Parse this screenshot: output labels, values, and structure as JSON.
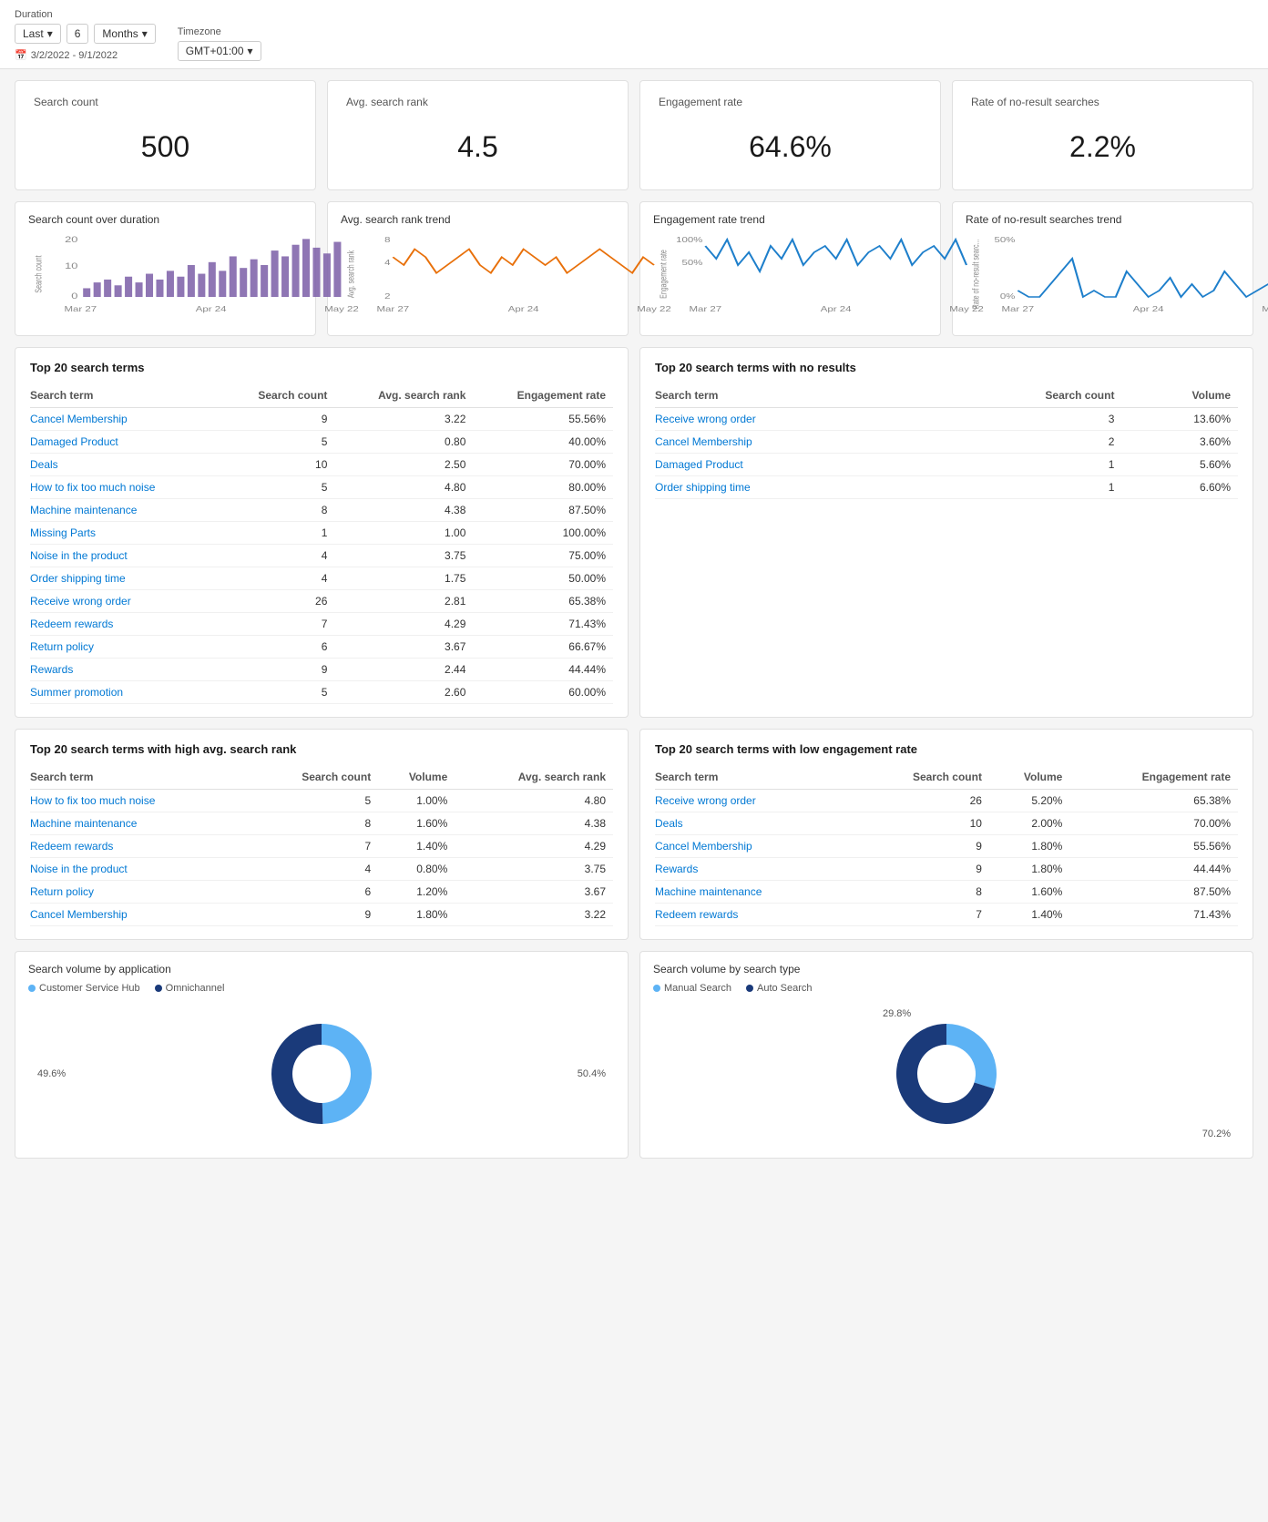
{
  "topbar": {
    "duration_label": "Duration",
    "period_option": "Last",
    "period_value": "6",
    "period_unit": "Months",
    "timezone_label": "Timezone",
    "timezone_value": "GMT+01:00",
    "date_range_icon": "calendar-icon",
    "date_range": "3/2/2022 - 9/1/2022"
  },
  "metrics": [
    {
      "title": "Search count",
      "value": "500"
    },
    {
      "title": "Avg. search rank",
      "value": "4.5"
    },
    {
      "title": "Engagement rate",
      "value": "64.6%"
    },
    {
      "title": "Rate of no-result searches",
      "value": "2.2%"
    }
  ],
  "trend_charts": [
    {
      "title": "Search count over duration",
      "y_label": "Search count",
      "color": "#7b5ea7",
      "type": "bar"
    },
    {
      "title": "Avg. search rank trend",
      "y_label": "Avg. search rank",
      "color": "#e8700a",
      "type": "line"
    },
    {
      "title": "Engagement rate trend",
      "y_label": "Engagement rate",
      "color": "#1e7fcb",
      "type": "line"
    },
    {
      "title": "Rate of no-result searches trend",
      "y_label": "Rate of no-result searc...",
      "color": "#1e7fcb",
      "type": "line"
    }
  ],
  "x_labels": [
    "Mar 27",
    "Apr 24",
    "May 22"
  ],
  "top20_table": {
    "title": "Top 20 search terms",
    "headers": [
      "Search term",
      "Search count",
      "Avg. search rank",
      "Engagement rate"
    ],
    "rows": [
      [
        "Cancel Membership",
        "9",
        "3.22",
        "55.56%"
      ],
      [
        "Damaged Product",
        "5",
        "0.80",
        "40.00%"
      ],
      [
        "Deals",
        "10",
        "2.50",
        "70.00%"
      ],
      [
        "How to fix too much noise",
        "5",
        "4.80",
        "80.00%"
      ],
      [
        "Machine maintenance",
        "8",
        "4.38",
        "87.50%"
      ],
      [
        "Missing Parts",
        "1",
        "1.00",
        "100.00%"
      ],
      [
        "Noise in the product",
        "4",
        "3.75",
        "75.00%"
      ],
      [
        "Order shipping time",
        "4",
        "1.75",
        "50.00%"
      ],
      [
        "Receive wrong order",
        "26",
        "2.81",
        "65.38%"
      ],
      [
        "Redeem rewards",
        "7",
        "4.29",
        "71.43%"
      ],
      [
        "Return policy",
        "6",
        "3.67",
        "66.67%"
      ],
      [
        "Rewards",
        "9",
        "2.44",
        "44.44%"
      ],
      [
        "Summer promotion",
        "5",
        "2.60",
        "60.00%"
      ]
    ]
  },
  "no_results_table": {
    "title": "Top 20 search terms with no results",
    "headers": [
      "Search term",
      "Search count",
      "Volume"
    ],
    "rows": [
      [
        "Receive wrong order",
        "3",
        "13.60%"
      ],
      [
        "Cancel Membership",
        "2",
        "3.60%"
      ],
      [
        "Damaged Product",
        "1",
        "5.60%"
      ],
      [
        "Order shipping time",
        "1",
        "6.60%"
      ]
    ]
  },
  "high_rank_table": {
    "title": "Top 20 search terms with high avg. search rank",
    "headers": [
      "Search term",
      "Search count",
      "Volume",
      "Avg. search rank"
    ],
    "rows": [
      [
        "How to fix too much noise",
        "5",
        "1.00%",
        "4.80"
      ],
      [
        "Machine maintenance",
        "8",
        "1.60%",
        "4.38"
      ],
      [
        "Redeem rewards",
        "7",
        "1.40%",
        "4.29"
      ],
      [
        "Noise in the product",
        "4",
        "0.80%",
        "3.75"
      ],
      [
        "Return policy",
        "6",
        "1.20%",
        "3.67"
      ],
      [
        "Cancel Membership",
        "9",
        "1.80%",
        "3.22"
      ]
    ]
  },
  "low_engagement_table": {
    "title": "Top 20 search terms with low engagement rate",
    "headers": [
      "Search term",
      "Search count",
      "Volume",
      "Engagement rate"
    ],
    "rows": [
      [
        "Receive wrong order",
        "26",
        "5.20%",
        "65.38%"
      ],
      [
        "Deals",
        "10",
        "2.00%",
        "70.00%"
      ],
      [
        "Cancel Membership",
        "9",
        "1.80%",
        "55.56%"
      ],
      [
        "Rewards",
        "9",
        "1.80%",
        "44.44%"
      ],
      [
        "Machine maintenance",
        "8",
        "1.60%",
        "87.50%"
      ],
      [
        "Redeem rewards",
        "7",
        "1.40%",
        "71.43%"
      ]
    ]
  },
  "donut_app": {
    "title": "Search volume by application",
    "legends": [
      {
        "label": "Customer Service Hub",
        "color": "#5db3f5"
      },
      {
        "label": "Omnichannel",
        "color": "#1a3a7a"
      }
    ],
    "values": [
      49.6,
      50.4
    ],
    "label_left": "49.6%",
    "label_right": "50.4%"
  },
  "donut_type": {
    "title": "Search volume by search type",
    "legends": [
      {
        "label": "Manual Search",
        "color": "#5db3f5"
      },
      {
        "label": "Auto Search",
        "color": "#1a3a7a"
      }
    ],
    "values": [
      29.8,
      70.2
    ],
    "label_top": "29.8%",
    "label_bottom": "70.2%"
  }
}
